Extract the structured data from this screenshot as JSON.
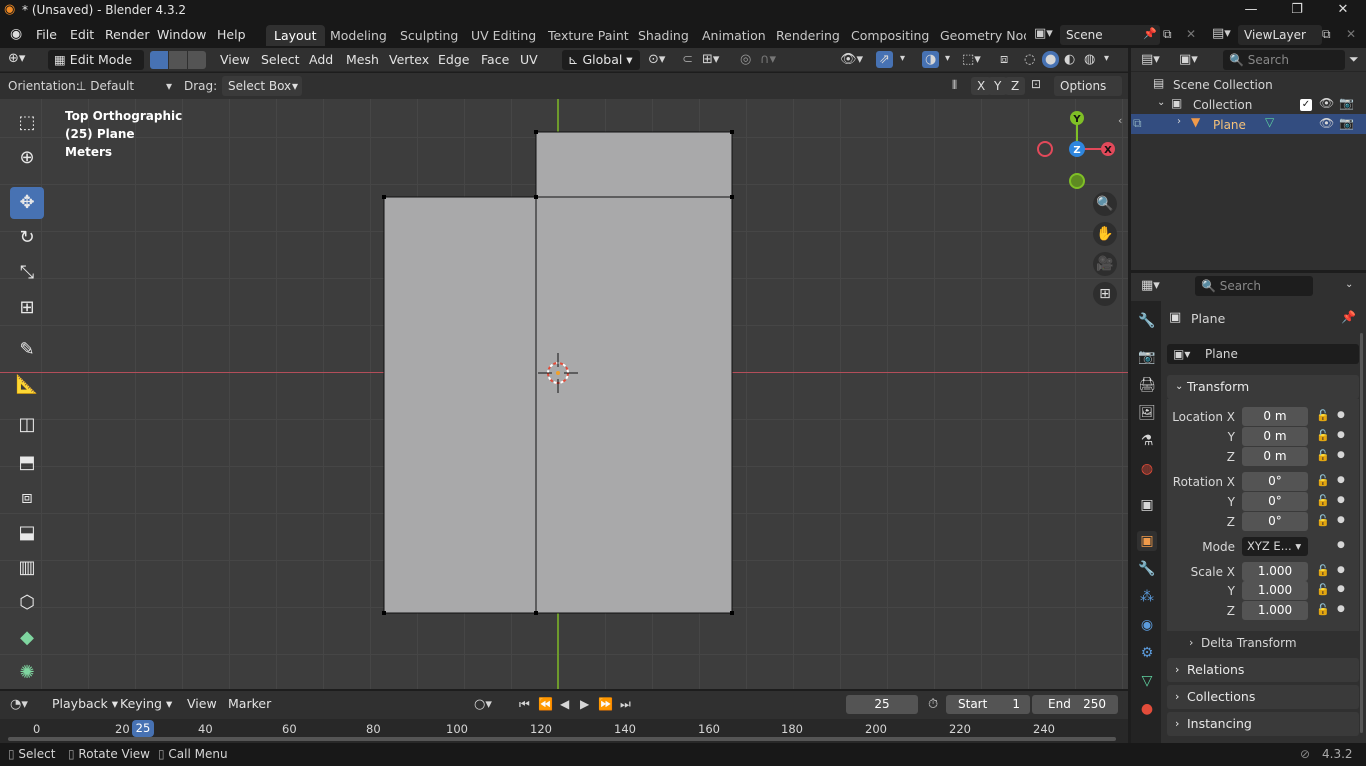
{
  "window": {
    "title": "* (Unsaved) - Blender 4.3.2"
  },
  "menu": {
    "items": [
      "File",
      "Edit",
      "Render",
      "Window",
      "Help"
    ]
  },
  "workspaces": {
    "tabs": [
      "Layout",
      "Modeling",
      "Sculpting",
      "UV Editing",
      "Texture Paint",
      "Shading",
      "Animation",
      "Rendering",
      "Compositing",
      "Geometry Node"
    ],
    "active": "Layout"
  },
  "scene": {
    "name": "Scene",
    "view_layer": "ViewLayer"
  },
  "view3d_header": {
    "mode": "Edit Mode",
    "menus": [
      "View",
      "Select",
      "Add",
      "Mesh",
      "Vertex",
      "Edge",
      "Face",
      "UV"
    ],
    "transform_orientation": "Global"
  },
  "tool_settings": {
    "orientation_label": "Orientation:",
    "orientation_value": "Default",
    "drag_label": "Drag:",
    "drag_value": "Select Box",
    "axes": [
      "X",
      "Y",
      "Z"
    ],
    "options_label": "Options"
  },
  "viewport": {
    "info_line1": "Top Orthographic",
    "info_line2": "(25) Plane",
    "info_line3": "Meters",
    "gizmo": {
      "x": "X",
      "y": "Y",
      "z": "Z"
    },
    "colors": {
      "background": "#3d3d3d",
      "grid": "#464646",
      "x_axis": "#b34e5a",
      "y_axis": "#6e9a2c",
      "mesh_face": "#a9a9aa",
      "active_tool": "#4772b3"
    }
  },
  "timeline": {
    "menus": [
      "Playback",
      "Keying",
      "View",
      "Marker"
    ],
    "current_frame": "25",
    "start_label": "Start",
    "start_value": "1",
    "end_label": "End",
    "end_value": "250",
    "ruler": [
      "0",
      "20",
      "40",
      "60",
      "80",
      "100",
      "120",
      "140",
      "160",
      "180",
      "200",
      "220",
      "240"
    ],
    "playhead": "25"
  },
  "statusbar": {
    "items": [
      "Select",
      "Rotate View",
      "Call Menu"
    ],
    "version": "4.3.2"
  },
  "outliner": {
    "search_placeholder": "Search",
    "scene_collection": "Scene Collection",
    "collection": "Collection",
    "object": "Plane"
  },
  "properties": {
    "search_placeholder": "Search",
    "object_name_header": "Plane",
    "object_name_field": "Plane",
    "transform_label": "Transform",
    "location_label": "Location X",
    "location": [
      "0 m",
      "0 m",
      "0 m"
    ],
    "rotation_label": "Rotation X",
    "rotation": [
      "0°",
      "0°",
      "0°"
    ],
    "mode_label": "Mode",
    "mode_value": "XYZ E...",
    "scale_label": "Scale X",
    "scale": [
      "1.000",
      "1.000",
      "1.000"
    ],
    "axis_y": "Y",
    "axis_z": "Z",
    "subpanels": [
      "Delta Transform",
      "Relations",
      "Collections",
      "Instancing"
    ]
  }
}
